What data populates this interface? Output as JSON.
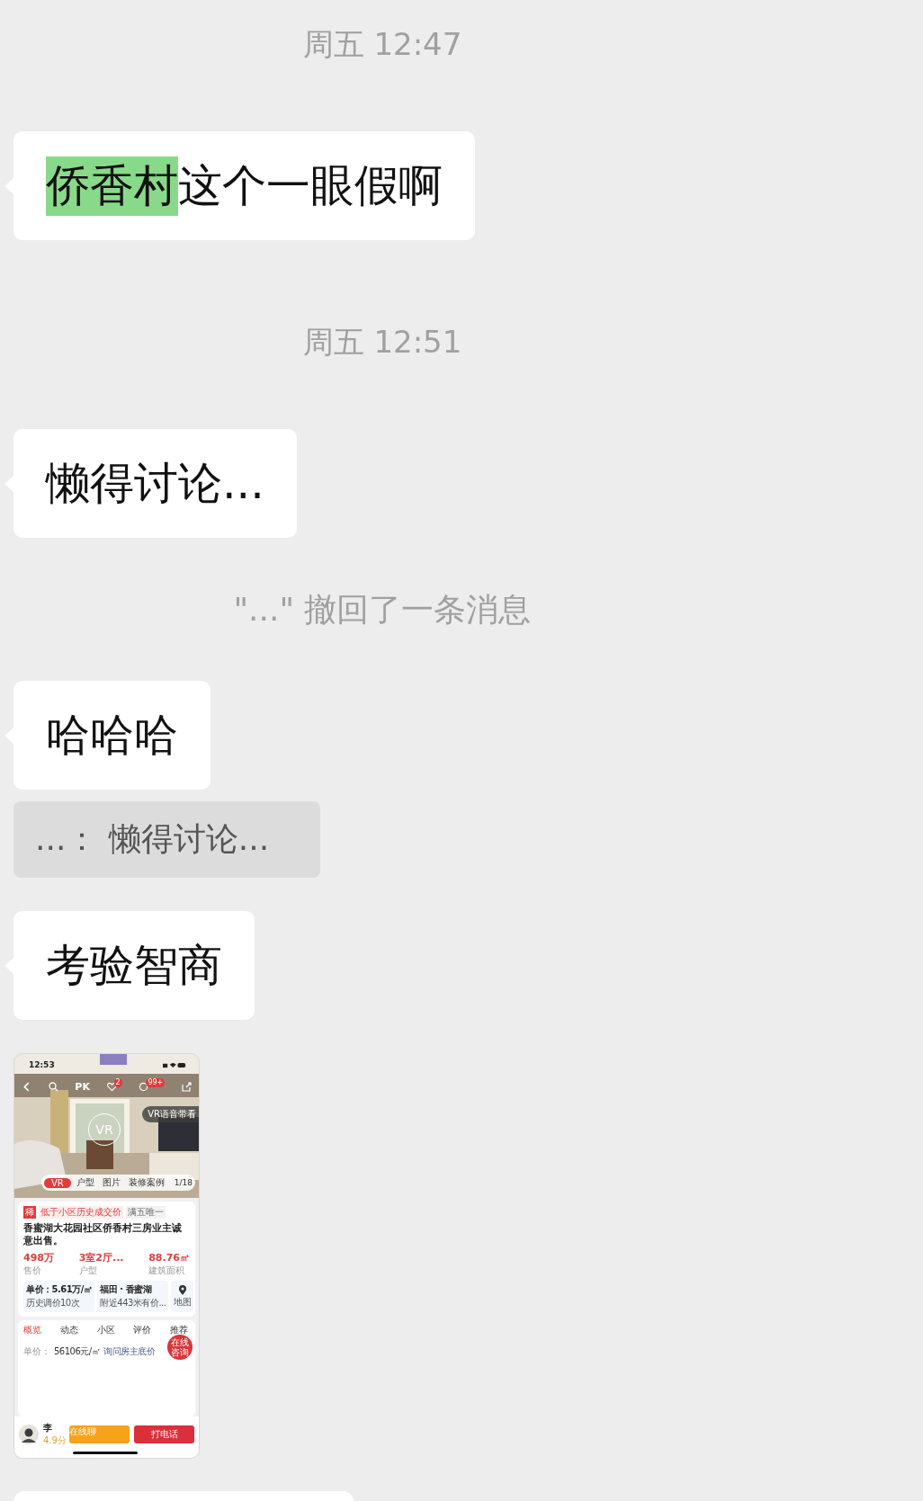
{
  "messages": [
    {
      "kind": "time",
      "text": "周五 12:47"
    },
    {
      "kind": "bubble",
      "parts": [
        {
          "text": "侨香村",
          "highlighted": true
        },
        {
          "text": "这个一眼假啊",
          "highlighted": false
        }
      ]
    },
    {
      "kind": "time",
      "text": "周五 12:51"
    },
    {
      "kind": "bubble",
      "parts": [
        {
          "text": "懒得讨论...",
          "highlighted": false
        }
      ]
    },
    {
      "kind": "recall",
      "text": "\"...\" 撤回了一条消息"
    },
    {
      "kind": "bubble",
      "parts": [
        {
          "text": "哈哈哈",
          "highlighted": false
        }
      ]
    },
    {
      "kind": "quote",
      "text": "...： 懒得讨论..."
    },
    {
      "kind": "bubble",
      "parts": [
        {
          "text": "考验智商",
          "highlighted": false
        }
      ]
    },
    {
      "listing": {
        "status_time": "12:53",
        "pk": "PK",
        "likes_badge": "2",
        "messages_badge": "99+",
        "vr_badge": "VR",
        "voice_tour": "VR语音带看",
        "media_tabs": [
          {
            "label": "VR",
            "selected": true
          },
          {
            "label": "户型",
            "selected": false
          },
          {
            "label": "图片",
            "selected": false
          },
          {
            "label": "装修案例",
            "selected": false
          }
        ],
        "photo_count": "1/18",
        "tags": [
          {
            "label": "稀",
            "kind": "mark"
          },
          {
            "label": "低于小区历史成交价",
            "kind": "highlight"
          },
          {
            "label": "满五唯一",
            "kind": "plain"
          }
        ],
        "title": "香蜜湖大花园社区侨香村三房业主诚意出售。",
        "stats": [
          {
            "value": "498万",
            "label": "售价"
          },
          {
            "value": "3室2厅...",
            "label": "户型"
          },
          {
            "value": "88.76㎡",
            "label": "建筑面积"
          }
        ],
        "info": [
          {
            "title": "单价：5.61万/㎡",
            "detail": "历史调价10次"
          },
          {
            "title": "福田 · 香蜜湖",
            "detail": "附近443米有价..."
          }
        ],
        "map_label": "地图",
        "section_tabs": [
          {
            "label": "概览",
            "selected": true
          },
          {
            "label": "动态",
            "selected": false
          },
          {
            "label": "小区",
            "selected": false
          },
          {
            "label": "评价",
            "selected": false
          },
          {
            "label": "推荐",
            "selected": false
          }
        ],
        "unit_price": {
          "label": "单价：",
          "value": "56106元/㎡",
          "link": "询问房主底价"
        },
        "consult_badge": "在线咨询",
        "agent": {
          "name": "李",
          "rating": "4.9分"
        },
        "actions": [
          {
            "label": "在线聊",
            "kind": "chat"
          },
          {
            "label": "打电话",
            "kind": "call"
          }
        ]
      }
    },
    {
      "kind": "partial"
    }
  ]
}
